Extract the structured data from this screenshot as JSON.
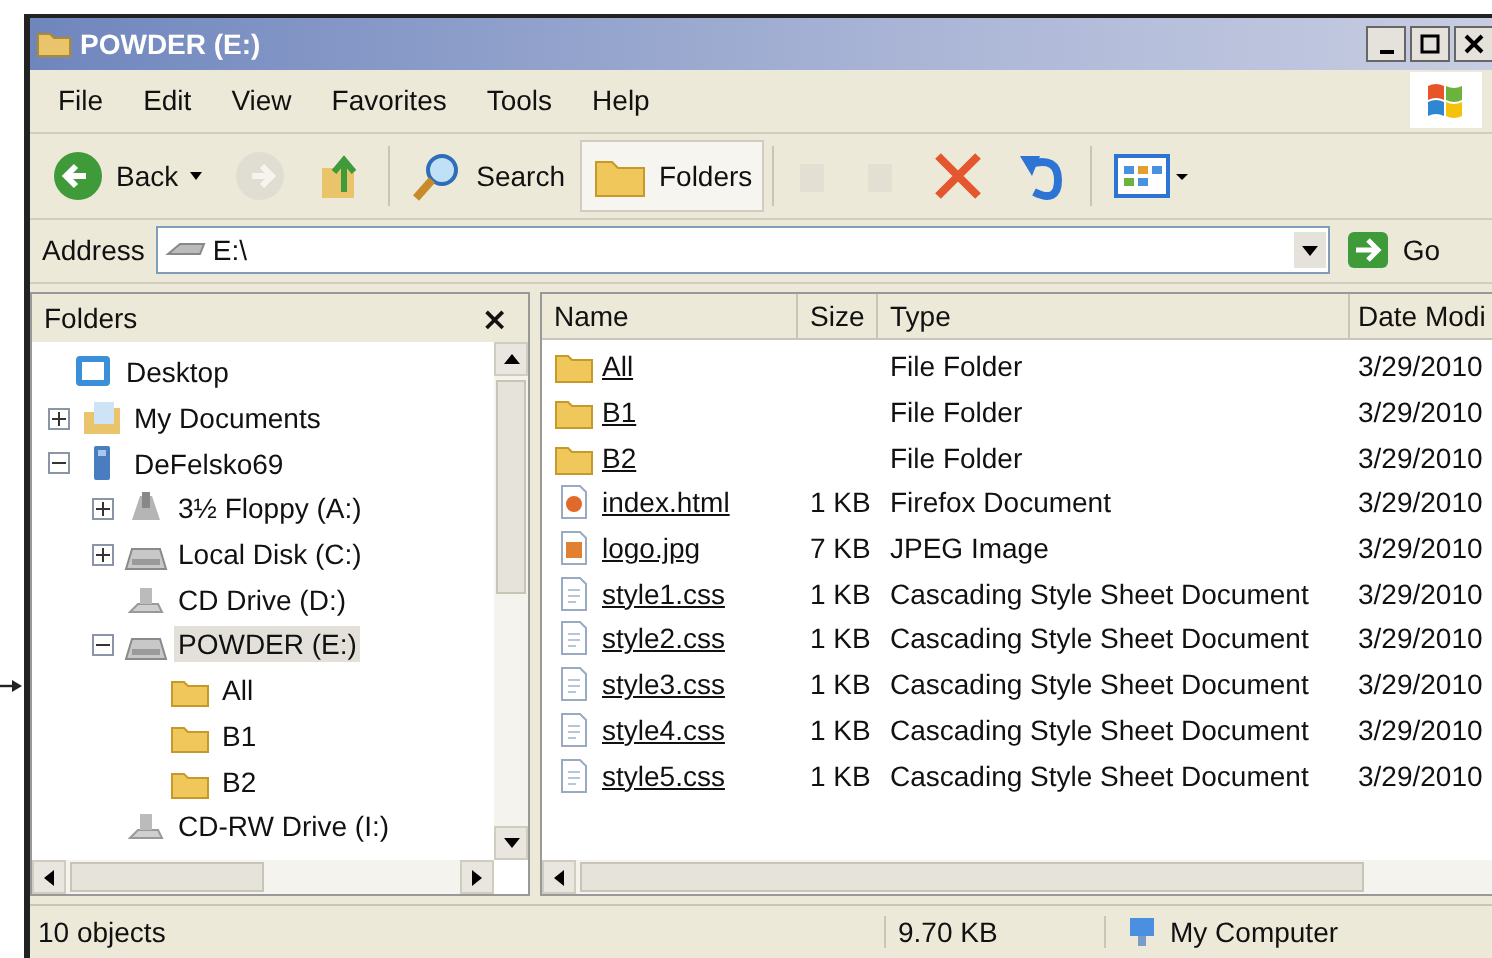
{
  "window": {
    "title": "POWDER (E:)"
  },
  "menu": [
    {
      "label": "File"
    },
    {
      "label": "Edit"
    },
    {
      "label": "View"
    },
    {
      "label": "Favorites"
    },
    {
      "label": "Tools"
    },
    {
      "label": "Help"
    }
  ],
  "toolbar": [
    {
      "kind": "back",
      "label": "Back",
      "disabled": false,
      "selected": false
    },
    {
      "kind": "forward",
      "disabled": true,
      "selected": false
    },
    {
      "kind": "up",
      "disabled": false,
      "selected": false
    },
    {
      "kind": "search",
      "label": "Search",
      "disabled": false,
      "selected": false
    },
    {
      "kind": "folders",
      "label": "Folders",
      "disabled": false,
      "selected": true
    },
    {
      "kind": "move",
      "disabled": true,
      "selected": false
    },
    {
      "kind": "copy",
      "disabled": true,
      "selected": false
    },
    {
      "kind": "delete",
      "disabled": false,
      "selected": false
    },
    {
      "kind": "undo",
      "disabled": false,
      "selected": false
    },
    {
      "kind": "views",
      "disabled": false,
      "selected": false
    }
  ],
  "address": {
    "label": "Address",
    "value": "E:\\",
    "go": "Go"
  },
  "folders": {
    "title": "Folders",
    "close": "×",
    "tree": [
      {
        "label": "Desktop",
        "kind": "desktop",
        "selected": false,
        "children": [
          {
            "label": "My Documents",
            "kind": "documents",
            "expanded": false,
            "selected": false
          },
          {
            "label": "DeFelsko69",
            "kind": "computer",
            "expanded": true,
            "selected": false,
            "children": [
              {
                "label": "3½ Floppy (A:)",
                "kind": "floppy",
                "expanded": false,
                "selected": false
              },
              {
                "label": "Local Disk (C:)",
                "kind": "disk",
                "expanded": false,
                "selected": false
              },
              {
                "label": "CD Drive (D:)",
                "kind": "cd",
                "selected": false
              },
              {
                "label": "POWDER (E:)",
                "kind": "disk",
                "expanded": true,
                "selected": true,
                "children": [
                  {
                    "label": "All",
                    "kind": "folder",
                    "selected": false
                  },
                  {
                    "label": "B1",
                    "kind": "folder",
                    "selected": false
                  },
                  {
                    "label": "B2",
                    "kind": "folder",
                    "selected": false
                  }
                ]
              },
              {
                "label": "CD-RW Drive (I:)",
                "kind": "cd",
                "selected": false
              }
            ]
          }
        ]
      }
    ]
  },
  "table": {
    "columns": [
      {
        "label": "Name"
      },
      {
        "label": "Size"
      },
      {
        "label": "Type"
      },
      {
        "label": "Date Modi"
      }
    ],
    "rows": [
      {
        "name": "All",
        "kind": "folder",
        "size": "",
        "type": "File Folder",
        "date": "3/29/2010"
      },
      {
        "name": "B1",
        "kind": "folder",
        "size": "",
        "type": "File Folder",
        "date": "3/29/2010"
      },
      {
        "name": "B2",
        "kind": "folder",
        "size": "",
        "type": "File Folder",
        "date": "3/29/2010"
      },
      {
        "name": "index.html",
        "kind": "html",
        "size": "1 KB",
        "type": "Firefox Document",
        "date": "3/29/2010"
      },
      {
        "name": "logo.jpg",
        "kind": "image",
        "size": "7 KB",
        "type": "JPEG Image",
        "date": "3/29/2010"
      },
      {
        "name": "style1.css",
        "kind": "css",
        "size": "1 KB",
        "type": "Cascading Style Sheet Document",
        "date": "3/29/2010"
      },
      {
        "name": "style2.css",
        "kind": "css",
        "size": "1 KB",
        "type": "Cascading Style Sheet Document",
        "date": "3/29/2010"
      },
      {
        "name": "style3.css",
        "kind": "css",
        "size": "1 KB",
        "type": "Cascading Style Sheet Document",
        "date": "3/29/2010"
      },
      {
        "name": "style4.css",
        "kind": "css",
        "size": "1 KB",
        "type": "Cascading Style Sheet Document",
        "date": "3/29/2010"
      },
      {
        "name": "style5.css",
        "kind": "css",
        "size": "1 KB",
        "type": "Cascading Style Sheet Document",
        "date": "3/29/2010"
      }
    ]
  },
  "status_bar": {
    "objects": "10 objects",
    "size": "9.70 KB",
    "zone": "My Computer"
  }
}
